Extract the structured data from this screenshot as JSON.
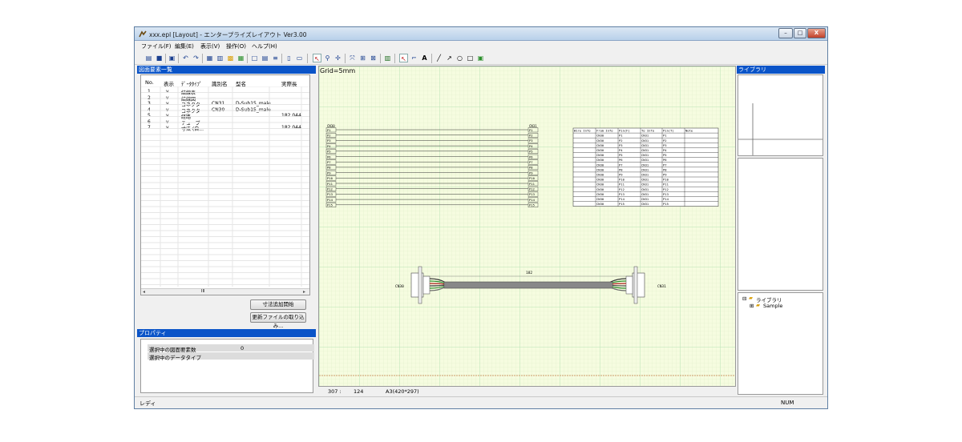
{
  "window": {
    "title": "xxx.epl [Layout] - エンタープライズレイアウト Ver3.00",
    "controls": {
      "minimize": "–",
      "maximize": "□",
      "close": "X"
    }
  },
  "menu": [
    "ファイル(F)",
    "編集(E)",
    "表示(V)",
    "操作(O)",
    "ヘルプ(H)"
  ],
  "toolbar_icons": [
    "open-folder-icon",
    "save-icon",
    "print-icon",
    "undo-icon",
    "redo-icon",
    "layout-icon",
    "copy-icon",
    "paste-icon",
    "grid-icon",
    "view-icon",
    "table-icon",
    "list-icon",
    "connector-icon",
    "split-icon",
    "select-icon",
    "zoom-icon",
    "pan-icon",
    "fit-icon",
    "zoom-in-icon",
    "zoom-out-icon",
    "layer-icon",
    "pointer-icon",
    "link-icon",
    "text-icon",
    "line-icon",
    "arrow-icon",
    "circle-icon",
    "rect-icon",
    "image-icon"
  ],
  "left_panel": {
    "title": "図面要素一覧",
    "headers": [
      "No.",
      "表示",
      "ﾃﾞｰﾀﾀｲﾌﾟ",
      "識別名",
      "型名",
      "実際長"
    ],
    "rows": [
      {
        "no": "1",
        "show": "v",
        "type": "結線表",
        "id": "",
        "model": "",
        "len": ""
      },
      {
        "no": "2",
        "show": "v",
        "type": "結線図",
        "id": "",
        "model": "",
        "len": ""
      },
      {
        "no": "3",
        "show": "v",
        "type": "コネクタ",
        "id": "CN31",
        "model": "D-Sub15_male",
        "len": ""
      },
      {
        "no": "4",
        "show": "v",
        "type": "コネクタ",
        "id": "CN30",
        "model": "D-Sub15_male",
        "len": ""
      },
      {
        "no": "5",
        "show": "v",
        "type": "経路",
        "id": "",
        "model": "",
        "len": "182.044"
      },
      {
        "no": "6",
        "show": "v",
        "type": "チューブ",
        "id": "",
        "model": "",
        "len": ""
      },
      {
        "no": "7",
        "show": "v",
        "type": "寸法 (自...",
        "id": "",
        "model": "",
        "len": "182.044"
      }
    ],
    "scroll_mid": "III",
    "btn_dimension": "寸法追加開始",
    "btn_import": "更新ファイルの取り込み..."
  },
  "props_panel": {
    "title": "プロパティ",
    "rows": [
      {
        "label": "選択中の図面要素数",
        "value": "0"
      },
      {
        "label": "選択中のデータタイプ",
        "value": ""
      }
    ]
  },
  "canvas": {
    "grid_label": "Grid=5mm",
    "cn_left": "CN30",
    "cn_right": "CN31",
    "pins": [
      "P1",
      "P2",
      "P3",
      "P4",
      "P5",
      "P6",
      "P7",
      "P8",
      "P9",
      "P10",
      "P11",
      "P12",
      "P13",
      "P14",
      "P15"
    ],
    "table_headers": [
      "Wire Info",
      "From Info",
      "Pin(F)",
      "To Info",
      "Pin(T)",
      "Note"
    ],
    "cable_length": "182",
    "cable_left_label": "CN30",
    "cable_right_label": "CN31",
    "status_x": "307 :",
    "status_y": "124",
    "paper": "A3(420*297)"
  },
  "right_panel": {
    "title": "ライブラリ",
    "tree_root": "ライブラリ",
    "tree_child": "Sample"
  },
  "statusbar": {
    "left": "レディ",
    "right": "NUM"
  }
}
